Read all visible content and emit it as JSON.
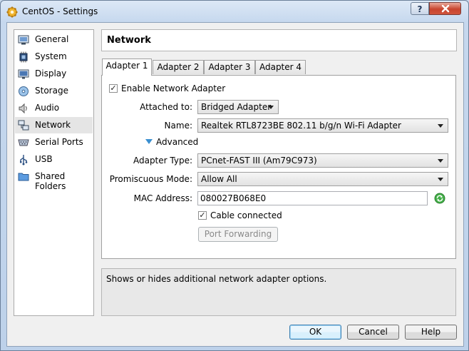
{
  "window": {
    "title": "CentOS - Settings"
  },
  "sidebar": {
    "items": [
      {
        "label": "General",
        "icon": "monitor-icon"
      },
      {
        "label": "System",
        "icon": "chip-icon"
      },
      {
        "label": "Display",
        "icon": "display-icon"
      },
      {
        "label": "Storage",
        "icon": "disk-icon"
      },
      {
        "label": "Audio",
        "icon": "speaker-icon"
      },
      {
        "label": "Network",
        "icon": "network-icon",
        "selected": true
      },
      {
        "label": "Serial Ports",
        "icon": "serial-port-icon"
      },
      {
        "label": "USB",
        "icon": "usb-icon"
      },
      {
        "label": "Shared Folders",
        "icon": "folder-icon"
      }
    ]
  },
  "header": {
    "title": "Network"
  },
  "tabs": [
    {
      "label": "Adapter 1",
      "active": true
    },
    {
      "label": "Adapter 2"
    },
    {
      "label": "Adapter 3"
    },
    {
      "label": "Adapter 4"
    }
  ],
  "adapter": {
    "enable_label": "Enable Network Adapter",
    "enable_checked": true,
    "attached_label": "Attached to:",
    "attached_value": "Bridged Adapter",
    "name_label": "Name:",
    "name_value": "Realtek RTL8723BE 802.11 b/g/n Wi-Fi Adapter",
    "advanced_label": "Advanced",
    "adapter_type_label": "Adapter Type:",
    "adapter_type_value": "PCnet-FAST III (Am79C973)",
    "promiscuous_label": "Promiscuous Mode:",
    "promiscuous_value": "Allow All",
    "mac_label": "MAC Address:",
    "mac_value": "080027B068E0",
    "cable_label": "Cable connected",
    "cable_checked": true,
    "port_forwarding_label": "Port Forwarding"
  },
  "description": {
    "text": "Shows or hides additional network adapter options."
  },
  "buttons": {
    "ok": "OK",
    "cancel": "Cancel",
    "help": "Help"
  },
  "colors": {
    "accent": "#3c7fb1",
    "selection": "#e5e5e5"
  }
}
